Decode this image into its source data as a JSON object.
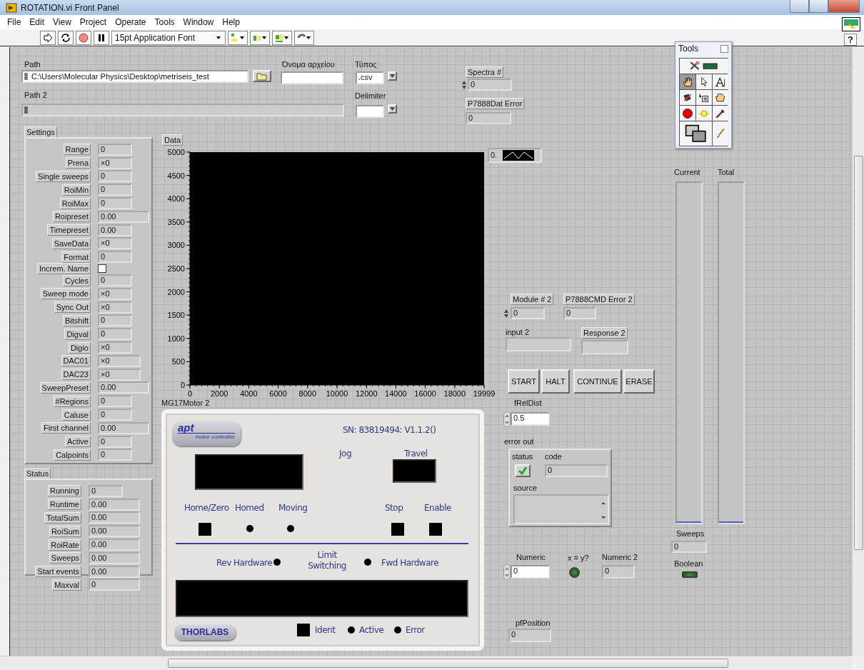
{
  "window": {
    "title": "ROTATION.vi Front Panel"
  },
  "menu": [
    "File",
    "Edit",
    "View",
    "Project",
    "Operate",
    "Tools",
    "Window",
    "Help"
  ],
  "toolbar": {
    "font": "15pt Application Font",
    "help": "?"
  },
  "path": {
    "label": "Path",
    "value": "C:\\Users\\Molecular Physics\\Desktop\\metriseis_test"
  },
  "filename": {
    "label": "Όνομα αρχείου"
  },
  "file_type": {
    "label": "Τύπος",
    "value": ".csv"
  },
  "path2": {
    "label": "Path 2"
  },
  "delimiter": {
    "label": "Delimiter"
  },
  "spectra": {
    "label": "Spectra #",
    "value": "0"
  },
  "dat_error": {
    "label": "P7888Dat Error",
    "value": "0"
  },
  "settings": {
    "label": "Settings",
    "items": [
      {
        "label": "Range",
        "value": "0",
        "kind": "short"
      },
      {
        "label": "Prena",
        "value": "×0",
        "kind": "short"
      },
      {
        "label": "Single sweeps",
        "value": "0",
        "kind": "short"
      },
      {
        "label": "RoiMin",
        "value": "0",
        "kind": "short"
      },
      {
        "label": "RoiMax",
        "value": "0",
        "kind": "short"
      },
      {
        "label": "Roipreset",
        "value": "0.00",
        "kind": "wide"
      },
      {
        "label": "Timepreset",
        "value": "0.00",
        "kind": "short"
      },
      {
        "label": "SaveData",
        "value": "×0",
        "kind": "short"
      },
      {
        "label": "Format",
        "value": "0",
        "kind": "short"
      },
      {
        "label": "Increm. Name",
        "kind": "checkbox",
        "checked": false
      },
      {
        "label": "Cycles",
        "value": "0",
        "kind": "short"
      },
      {
        "label": "Sweep mode",
        "value": "×0",
        "kind": "short"
      },
      {
        "label": "Sync Out",
        "value": "×0",
        "kind": "short"
      },
      {
        "label": "Bitshift",
        "value": "0",
        "kind": "short"
      },
      {
        "label": "Digval",
        "value": "0",
        "kind": "short"
      },
      {
        "label": "Digio",
        "value": "×0",
        "kind": "short"
      },
      {
        "label": "DAC01",
        "value": "×0",
        "kind": "medium"
      },
      {
        "label": "DAC23",
        "value": "×0",
        "kind": "medium"
      },
      {
        "label": "SweepPreset",
        "value": "0.00",
        "kind": "wide"
      },
      {
        "label": "#Regions",
        "value": "0",
        "kind": "short"
      },
      {
        "label": "Caluse",
        "value": "0",
        "kind": "short"
      },
      {
        "label": "First channel",
        "value": "0.00",
        "kind": "wide"
      },
      {
        "label": "Active",
        "value": "0",
        "kind": "short"
      },
      {
        "label": "Calpoints",
        "value": "0",
        "kind": "short"
      }
    ]
  },
  "status": {
    "label": "Status",
    "items": [
      {
        "label": "Running",
        "value": "0",
        "kind": "short"
      },
      {
        "label": "Runtime",
        "value": "0.00",
        "kind": "wide"
      },
      {
        "label": "TotalSum",
        "value": "0.00",
        "kind": "wide"
      },
      {
        "label": "RoiSum",
        "value": "0.00",
        "kind": "wide"
      },
      {
        "label": "RoiRate",
        "value": "0.00",
        "kind": "wide"
      },
      {
        "label": "Sweeps",
        "value": "0.00",
        "kind": "wide"
      },
      {
        "label": "Start events",
        "value": "0.00",
        "kind": "wide"
      },
      {
        "label": "Maxval",
        "value": "0",
        "kind": "wide"
      }
    ]
  },
  "graph": {
    "legend": "0.",
    "chart_data": {
      "type": "line",
      "title": "Data",
      "xlim": [
        0,
        19999
      ],
      "ylim": [
        0,
        5000
      ],
      "xticks": [
        0,
        2000,
        4000,
        6000,
        8000,
        10000,
        12000,
        14000,
        16000,
        18000,
        19999
      ],
      "yticks": [
        0,
        500,
        1000,
        1500,
        2000,
        2500,
        3000,
        3500,
        4000,
        4500,
        5000
      ]
    }
  },
  "motor": {
    "label": "MG17Motor 2",
    "logo": "apt",
    "logo_sub": "motor controller",
    "serial": "SN: 83819494: V1.1.2()",
    "jog": "Jog",
    "travel": "Travel",
    "indicators": [
      {
        "label": "Home/Zero",
        "kind": "button"
      },
      {
        "label": "Homed",
        "kind": "led"
      },
      {
        "label": "Moving",
        "kind": "led"
      },
      {
        "label": "Stop",
        "kind": "button"
      },
      {
        "label": "Enable",
        "kind": "button"
      }
    ],
    "rev": "Rev Hardware",
    "limit": "Limit Switching",
    "fwd": "Fwd Hardware",
    "brand": "THORLABS",
    "footer": [
      {
        "label": "Ident",
        "kind": "button"
      },
      {
        "label": "Active",
        "kind": "led"
      },
      {
        "label": "Error",
        "kind": "led"
      }
    ]
  },
  "module": {
    "label": "Module # 2",
    "value": "0"
  },
  "cmd_error": {
    "label": "P7888CMD Error 2",
    "value": "0"
  },
  "input2": {
    "label": "input 2"
  },
  "response2": {
    "label": "Response 2"
  },
  "buttons": [
    "START",
    "HALT",
    "CONTINUE",
    "ERASE"
  ],
  "rel_dist": {
    "label": "fRelDist",
    "value": "0.5"
  },
  "error_out": {
    "label": "error out",
    "status_label": "status",
    "checked": true,
    "code_label": "code",
    "code": "0",
    "source_label": "source"
  },
  "numeric": {
    "label": "Numeric",
    "value": "0"
  },
  "compare": {
    "label": "x = y?",
    "on": false
  },
  "numeric2": {
    "label": "Numeric 2",
    "value": "0"
  },
  "position": {
    "label": "pfPosition",
    "value": "0"
  },
  "meters": [
    {
      "label": "Current",
      "level": 0
    },
    {
      "label": "Total",
      "level": 0
    }
  ],
  "sweeps": {
    "label": "Sweeps",
    "value": "0"
  },
  "boolean": {
    "label": "Boolean",
    "on": false
  },
  "tools": {
    "title": "Tools",
    "items": [
      {
        "kind": "auto",
        "selected": false
      },
      {
        "kind": "operate",
        "selected": true
      },
      {
        "kind": "position",
        "selected": false
      },
      {
        "kind": "text",
        "selected": false
      },
      {
        "kind": "wire",
        "selected": false
      },
      {
        "kind": "shortcut",
        "selected": false
      },
      {
        "kind": "scroll",
        "selected": false
      },
      {
        "kind": "breakpoint",
        "selected": false
      },
      {
        "kind": "probe",
        "selected": false
      },
      {
        "kind": "getcolor",
        "selected": false
      },
      {
        "kind": "setcolor",
        "selected": false
      },
      {
        "kind": "brush",
        "selected": false
      }
    ]
  }
}
